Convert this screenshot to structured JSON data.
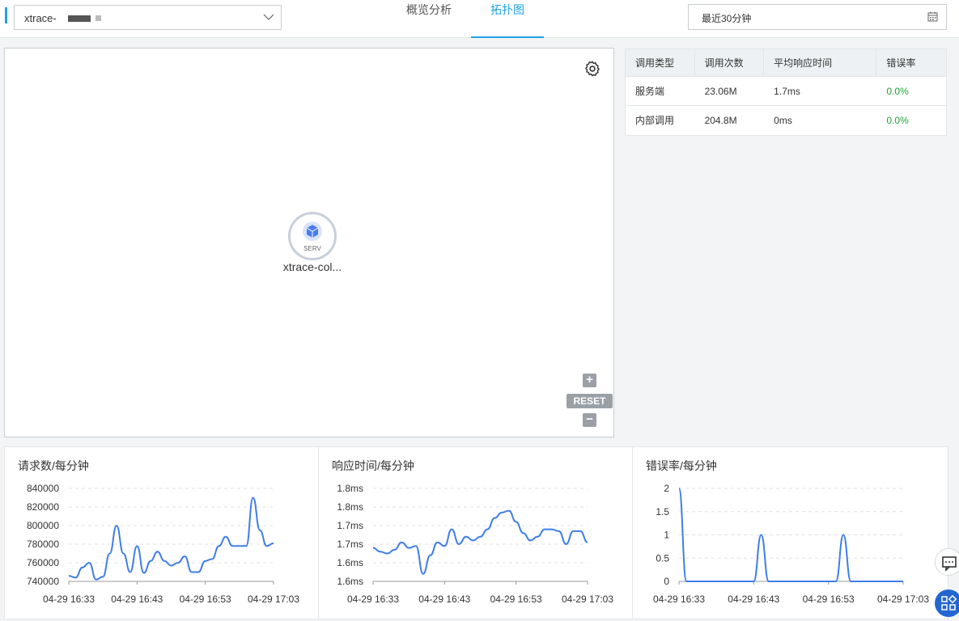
{
  "header": {
    "app_select_value": "xtrace-",
    "tabs": [
      {
        "label": "概览分析"
      },
      {
        "label": "拓扑图"
      }
    ],
    "active_tab": "拓扑图",
    "time_range": "最近30分钟"
  },
  "topology": {
    "node": {
      "badge": "SERV",
      "label": "xtrace-col..."
    },
    "controls": {
      "reset": "RESET"
    }
  },
  "table": {
    "headers": [
      "调用类型",
      "调用次数",
      "平均响应时间",
      "错误率"
    ],
    "rows": [
      {
        "type": "服务端",
        "count": "23.06M",
        "avg": "1.7ms",
        "err": "0.0%"
      },
      {
        "type": "内部调用",
        "count": "204.8M",
        "avg": "0ms",
        "err": "0.0%"
      }
    ]
  },
  "colors": {
    "accent": "#1fa3e4",
    "line": "#3f7ee8",
    "ok": "#1ea337"
  },
  "chart_data": [
    {
      "type": "line",
      "title": "请求数/每分钟",
      "x_ticks": [
        "04-29 16:33",
        "04-29 16:43",
        "04-29 16:53",
        "04-29 17:03"
      ],
      "y_ticks": [
        "740000",
        "760000",
        "780000",
        "800000",
        "820000",
        "840000"
      ],
      "ylim": [
        740000,
        840000
      ],
      "values": [
        746000,
        744000,
        755000,
        760000,
        742000,
        745000,
        770000,
        800000,
        770000,
        750000,
        778000,
        749000,
        762000,
        772000,
        762000,
        757000,
        760000,
        767000,
        750000,
        750000,
        762000,
        764000,
        778000,
        788000,
        778000,
        778000,
        778000,
        830000,
        795000,
        778000,
        781000
      ]
    },
    {
      "type": "line",
      "title": "响应时间/每分钟",
      "x_ticks": [
        "04-29 16:33",
        "04-29 16:43",
        "04-29 16:53",
        "04-29 17:03"
      ],
      "y_ticks": [
        "1.6ms",
        "1.6ms",
        "1.7ms",
        "1.7ms",
        "1.8ms",
        "1.8ms"
      ],
      "ylim": [
        1.6,
        1.85
      ],
      "values": [
        1.69,
        1.68,
        1.675,
        1.685,
        1.705,
        1.69,
        1.695,
        1.62,
        1.67,
        1.705,
        1.695,
        1.74,
        1.7,
        1.72,
        1.71,
        1.72,
        1.74,
        1.77,
        1.785,
        1.79,
        1.76,
        1.73,
        1.71,
        1.72,
        1.74,
        1.74,
        1.735,
        1.7,
        1.735,
        1.735,
        1.705
      ]
    },
    {
      "type": "line",
      "title": "错误率/每分钟",
      "x_ticks": [
        "04-29 16:33",
        "04-29 16:43",
        "04-29 16:53",
        "04-29 17:03"
      ],
      "y_ticks": [
        "0",
        "0.5",
        "1",
        "1.5",
        "2"
      ],
      "ylim": [
        0,
        2
      ],
      "values": [
        2,
        0,
        0,
        0,
        0,
        0,
        0,
        0,
        0,
        0,
        0,
        1,
        0,
        0,
        0,
        0,
        0,
        0,
        0,
        0,
        0,
        0,
        1,
        0,
        0,
        0,
        0,
        0,
        0,
        0,
        0
      ]
    }
  ]
}
